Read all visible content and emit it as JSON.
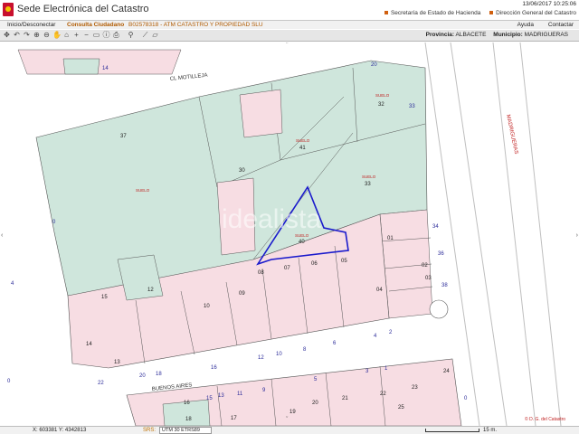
{
  "header": {
    "title": "Sede Electrónica del Catastro",
    "datetime": "13/06/2017  10:25:06",
    "links": [
      "Secretaría de Estado de Hacienda",
      "Dirección General del Catastro"
    ]
  },
  "menubar": {
    "login": "Inicio/Desconectar",
    "user_label": "Consulta Ciudadano",
    "user_detail": "B02578318 - ATM CATASTRO Y PROPIEDAD SLU",
    "help": "Ayuda",
    "contact": "Contactar"
  },
  "toolbar": {
    "tools": [
      {
        "icon": "arrows-move-icon",
        "glyph": "✥"
      },
      {
        "icon": "undo-icon",
        "glyph": "↶"
      },
      {
        "icon": "redo-icon",
        "glyph": "↷"
      },
      {
        "icon": "zoom-in-icon",
        "glyph": "⊕"
      },
      {
        "icon": "zoom-out-icon",
        "glyph": "⊖"
      },
      {
        "icon": "hand-pan-icon",
        "glyph": "✋"
      },
      {
        "icon": "full-extent-icon",
        "glyph": "⌂"
      },
      {
        "icon": "plus-icon",
        "glyph": "+"
      },
      {
        "icon": "minus-icon",
        "glyph": "−"
      },
      {
        "icon": "rectangle-icon",
        "glyph": "▭"
      },
      {
        "icon": "info-icon",
        "glyph": "ⓘ"
      },
      {
        "icon": "print-icon",
        "glyph": "⎙"
      },
      {
        "icon": "separator",
        "glyph": ""
      },
      {
        "icon": "location-pin-icon",
        "glyph": "⚲"
      },
      {
        "icon": "separator",
        "glyph": ""
      },
      {
        "icon": "ruler-icon",
        "glyph": "⟋"
      },
      {
        "icon": "area-icon",
        "glyph": "▱"
      }
    ],
    "province_label": "Provincia:",
    "province_value": "ALBACETE",
    "municipality_label": "Municipio:",
    "municipality_value": "MADRIGUERAS"
  },
  "map": {
    "streets": {
      "top": "CL MOTILLEJA",
      "right": "MADRIGUERAS",
      "bottom": "BUENOS   AIRES"
    },
    "parcels": [
      "37",
      "30",
      "41",
      "33",
      "32",
      "40",
      "01",
      "02",
      "03",
      "04",
      "05",
      "06",
      "07",
      "08",
      "09",
      "10",
      "12",
      "13",
      "14",
      "15",
      "16",
      "17",
      "18",
      "19",
      "20",
      "21",
      "22",
      "23",
      "24",
      "25"
    ],
    "numbers": [
      "14",
      "20",
      "15",
      "13",
      "11",
      "9",
      "6",
      "4",
      "2",
      "12",
      "10",
      "8",
      "18",
      "16",
      "22",
      "20",
      "5",
      "3",
      "1",
      "0",
      "0",
      "0",
      "33",
      "34",
      "36",
      "38",
      "4"
    ],
    "labels": {
      "suelo": "SUELO",
      "parcel_label": "SUELO"
    },
    "watermark": "idealista",
    "copyright": "© D. G. del Catastro"
  },
  "status": {
    "coords": "X: 603381  Y: 4342813",
    "srs_label": "SRS:",
    "srs_value": "UTM 30 ETRS89",
    "scale_label": "15 m."
  },
  "colors": {
    "green_parcel": "#cfe6dc",
    "pink_parcel": "#f7dde3",
    "boundary": "#1a1acc",
    "street_blue": "#2b2b99",
    "accent_orange": "#d06010"
  }
}
